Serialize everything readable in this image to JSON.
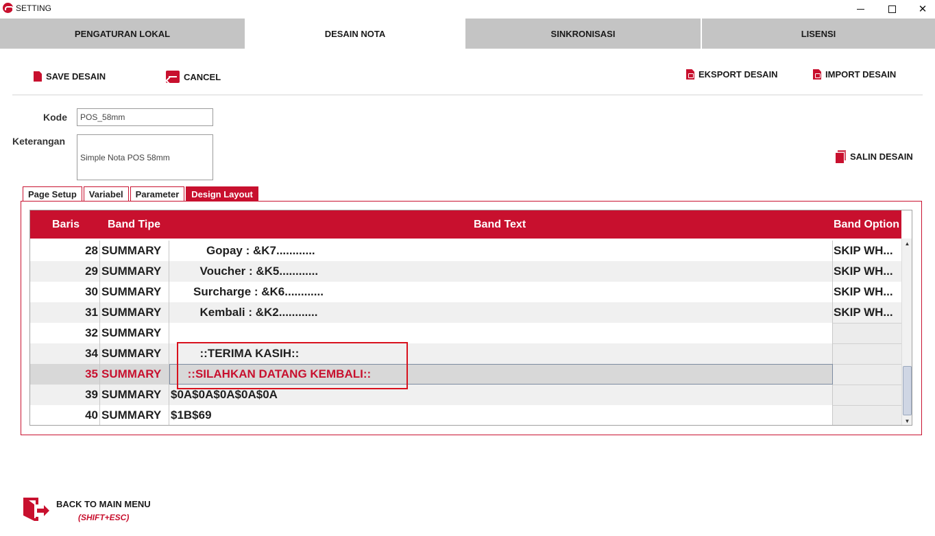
{
  "window": {
    "title": "SETTING"
  },
  "main_tabs": [
    "PENGATURAN LOKAL",
    "DESAIN NOTA",
    "SINKRONISASI",
    "LISENSI"
  ],
  "toolbar": {
    "save": "SAVE DESAIN",
    "cancel": "CANCEL",
    "export": "EKSPORT DESAIN",
    "import": "IMPORT DESAIN",
    "copy": "SALIN DESAIN"
  },
  "form": {
    "kode_label": "Kode",
    "kode_value": "POS_58mm",
    "keterangan_label": "Keterangan",
    "keterangan_value": "Simple Nota POS 58mm"
  },
  "inner_tabs": [
    "Page Setup",
    "Variabel",
    "Parameter",
    "Design Layout"
  ],
  "table": {
    "headers": {
      "baris": "Baris",
      "tipe": "Band Tipe",
      "text": "Band Text",
      "option": "Band Option"
    },
    "rows": [
      {
        "baris": "28",
        "tipe": "SUMMARY",
        "text": "           Gopay : &K7............",
        "option": "SKIP WH..."
      },
      {
        "baris": "29",
        "tipe": "SUMMARY",
        "text": "         Voucher : &K5............",
        "option": "SKIP WH..."
      },
      {
        "baris": "30",
        "tipe": "SUMMARY",
        "text": "       Surcharge : &K6............",
        "option": "SKIP WH..."
      },
      {
        "baris": "31",
        "tipe": "SUMMARY",
        "text": "         Kembali : &K2............",
        "option": "SKIP WH..."
      },
      {
        "baris": "32",
        "tipe": "SUMMARY",
        "text": "",
        "option": ""
      },
      {
        "baris": "34",
        "tipe": "SUMMARY",
        "text": "         ::TERIMA KASIH::",
        "option": ""
      },
      {
        "baris": "35",
        "tipe": "SUMMARY",
        "text": "     ::SILAHKAN DATANG KEMBALI::",
        "option": ""
      },
      {
        "baris": "39",
        "tipe": "SUMMARY",
        "text": "$0A$0A$0A$0A$0A",
        "option": ""
      },
      {
        "baris": "40",
        "tipe": "SUMMARY",
        "text": "$1B$69",
        "option": ""
      }
    ]
  },
  "back": {
    "label": "BACK TO MAIN MENU",
    "shortcut": "(SHIFT+ESC)"
  },
  "colors": {
    "accent": "#c8102e",
    "tab_inactive": "#c4c4c4"
  }
}
